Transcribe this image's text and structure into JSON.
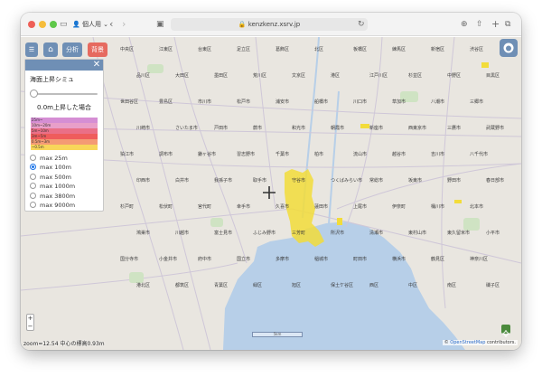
{
  "browser": {
    "profile_label": "個人用",
    "url": "kenzkenz.xsrv.jp"
  },
  "map_buttons": {
    "home_label": "⌂",
    "analysis_label": "分析",
    "background_label": "背景"
  },
  "panel": {
    "title": "海面上昇シミュ",
    "slider_value": 0,
    "value_text": "0.0m上昇した場合",
    "legend": [
      {
        "label": "25m~",
        "color": "#d58ed4"
      },
      {
        "label": "10m~20m",
        "color": "#e89fc9"
      },
      {
        "label": "5m~10m",
        "color": "#ea6f87"
      },
      {
        "label": "3m~5m",
        "color": "#ef5c5c"
      },
      {
        "label": "0.5m~3m",
        "color": "#f49a74"
      },
      {
        "label": "~0.5m",
        "color": "#f8d65a"
      }
    ],
    "options": [
      {
        "label": "max 25m",
        "selected": false
      },
      {
        "label": "max 100m",
        "selected": true
      },
      {
        "label": "max 500m",
        "selected": false
      },
      {
        "label": "max 1000m",
        "selected": false
      },
      {
        "label": "max 3800m",
        "selected": false
      },
      {
        "label": "max 9000m",
        "selected": false
      }
    ]
  },
  "map": {
    "zoom_info": "zoom=12.54 中心の標高0.93m",
    "attribution_prefix": "© ",
    "attribution_link": "OpenStreetMap",
    "attribution_suffix": " contributors.",
    "scale_label": "5km",
    "zoom_in": "+",
    "zoom_out": "−",
    "place_labels": [
      "中央区",
      "江東区",
      "台東区",
      "足立区",
      "葛飾区",
      "北区",
      "板橋区",
      "練馬区",
      "新宿区",
      "渋谷区",
      "品川区",
      "大田区",
      "墨田区",
      "荒川区",
      "文京区",
      "港区",
      "江戸川区",
      "杉並区",
      "中野区",
      "目黒区",
      "世田谷区",
      "豊島区",
      "市川市",
      "松戸市",
      "浦安市",
      "船橋市",
      "川口市",
      "草加市",
      "八潮市",
      "三郷市",
      "川崎市",
      "さいたま市",
      "戸田市",
      "蕨市",
      "和光市",
      "朝霞市",
      "新座市",
      "西東京市",
      "三鷹市",
      "武蔵野市",
      "狛江市",
      "調布市",
      "鎌ヶ谷市",
      "習志野市",
      "千葉市",
      "柏市",
      "流山市",
      "越谷市",
      "吉川市",
      "八千代市",
      "印西市",
      "白井市",
      "我孫子市",
      "取手市",
      "守谷市",
      "つくばみらい市",
      "常総市",
      "坂東市",
      "野田市",
      "春日部市",
      "杉戸町",
      "松伏町",
      "宮代町",
      "幸手市",
      "久喜市",
      "蓮田市",
      "上尾市",
      "伊奈町",
      "桶川市",
      "北本市",
      "鴻巣市",
      "川越市",
      "富士見市",
      "ふじみ野市",
      "三芳町",
      "所沢市",
      "清瀬市",
      "東村山市",
      "東久留米市",
      "小平市",
      "国分寺市",
      "小金井市",
      "府中市",
      "国立市",
      "多摩市",
      "稲城市",
      "町田市",
      "横浜市",
      "鶴見区",
      "神奈川区",
      "港北区",
      "都筑区",
      "青葉区",
      "緑区",
      "旭区",
      "保土ケ谷区",
      "西区",
      "中区",
      "南区",
      "磯子区"
    ]
  },
  "colors": {
    "accent": "#6f8fb5",
    "background_button": "#e66a5f",
    "flood": "#f2dc3a",
    "water": "#b7cfe8"
  }
}
